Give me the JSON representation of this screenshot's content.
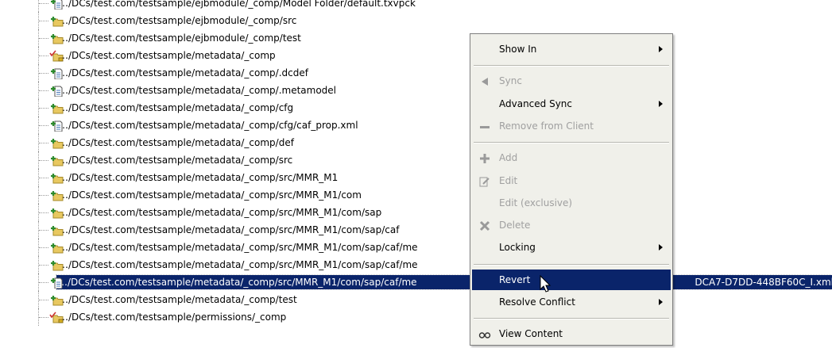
{
  "tree": {
    "rows": [
      {
        "path": "…/DCs/test.com/testsample/ejbmodule/_comp/Model Folder/default.txvpck",
        "icon": "file-add-icon",
        "trail": ""
      },
      {
        "path": "…/DCs/test.com/testsample/ejbmodule/_comp/src",
        "icon": "folder-add-icon",
        "trail": ""
      },
      {
        "path": "…/DCs/test.com/testsample/ejbmodule/_comp/test",
        "icon": "folder-add-icon",
        "trail": ""
      },
      {
        "path": "…/DCs/test.com/testsample/metadata/_comp",
        "icon": "folder-edit-icon",
        "trail": ""
      },
      {
        "path": "…/DCs/test.com/testsample/metadata/_comp/.dcdef",
        "icon": "file-add-icon",
        "trail": ""
      },
      {
        "path": "…/DCs/test.com/testsample/metadata/_comp/.metamodel",
        "icon": "file-add-icon",
        "trail": ""
      },
      {
        "path": "…/DCs/test.com/testsample/metadata/_comp/cfg",
        "icon": "folder-add-icon",
        "trail": ""
      },
      {
        "path": "…/DCs/test.com/testsample/metadata/_comp/cfg/caf_prop.xml",
        "icon": "file-add-icon",
        "trail": ""
      },
      {
        "path": "…/DCs/test.com/testsample/metadata/_comp/def",
        "icon": "folder-add-icon",
        "trail": ""
      },
      {
        "path": "…/DCs/test.com/testsample/metadata/_comp/src",
        "icon": "folder-add-icon",
        "trail": ""
      },
      {
        "path": "…/DCs/test.com/testsample/metadata/_comp/src/MMR_M1",
        "icon": "folder-add-icon",
        "trail": ""
      },
      {
        "path": "…/DCs/test.com/testsample/metadata/_comp/src/MMR_M1/com",
        "icon": "folder-add-icon",
        "trail": ""
      },
      {
        "path": "…/DCs/test.com/testsample/metadata/_comp/src/MMR_M1/com/sap",
        "icon": "folder-add-icon",
        "trail": ""
      },
      {
        "path": "…/DCs/test.com/testsample/metadata/_comp/src/MMR_M1/com/sap/caf",
        "icon": "folder-add-icon",
        "trail": ""
      },
      {
        "path": "…/DCs/test.com/testsample/metadata/_comp/src/MMR_M1/com/sap/caf/me",
        "icon": "folder-add-icon",
        "trail": ""
      },
      {
        "path": "…/DCs/test.com/testsample/metadata/_comp/src/MMR_M1/com/sap/caf/me",
        "icon": "folder-add-icon",
        "trail": ""
      },
      {
        "path": "…/DCs/test.com/testsample/metadata/_comp/src/MMR_M1/com/sap/caf/me",
        "icon": "file-add-icon",
        "trail": "DCA7-D7DD-448BF60C_I.xml",
        "selected": true
      },
      {
        "path": "…/DCs/test.com/testsample/metadata/_comp/test",
        "icon": "folder-add-icon",
        "trail": ""
      },
      {
        "path": "…/DCs/test.com/testsample/permissions/_comp",
        "icon": "folder-edit-icon",
        "trail": ""
      }
    ]
  },
  "menu": {
    "items": [
      {
        "label": "Show In",
        "submenu": true,
        "enabled": true,
        "icon": ""
      },
      {
        "sep": true
      },
      {
        "label": "Sync",
        "submenu": false,
        "enabled": false,
        "icon": "sync-icon"
      },
      {
        "label": "Advanced Sync",
        "submenu": true,
        "enabled": true,
        "icon": ""
      },
      {
        "label": "Remove from Client",
        "submenu": false,
        "enabled": false,
        "icon": "remove-icon"
      },
      {
        "sep": true
      },
      {
        "label": "Add",
        "submenu": false,
        "enabled": false,
        "icon": "add-icon"
      },
      {
        "label": "Edit",
        "submenu": false,
        "enabled": false,
        "icon": "edit-icon"
      },
      {
        "label": "Edit (exclusive)",
        "submenu": false,
        "enabled": false,
        "icon": ""
      },
      {
        "label": "Delete",
        "submenu": false,
        "enabled": false,
        "icon": "delete-icon"
      },
      {
        "label": "Locking",
        "submenu": true,
        "enabled": true,
        "icon": ""
      },
      {
        "sep": true
      },
      {
        "label": "Revert",
        "submenu": false,
        "enabled": true,
        "icon": "",
        "highlight": true
      },
      {
        "label": "Resolve Conflict",
        "submenu": true,
        "enabled": true,
        "icon": ""
      },
      {
        "sep": true
      },
      {
        "label": "View Content",
        "submenu": false,
        "enabled": true,
        "icon": "view-content-icon"
      }
    ]
  },
  "colors": {
    "selection": "#0a246a",
    "menu_bg": "#f0f0ea",
    "disabled_text": "#a0a0a0",
    "plus_green": "#2e8b2e",
    "folder_yellow": "#e8c860"
  }
}
